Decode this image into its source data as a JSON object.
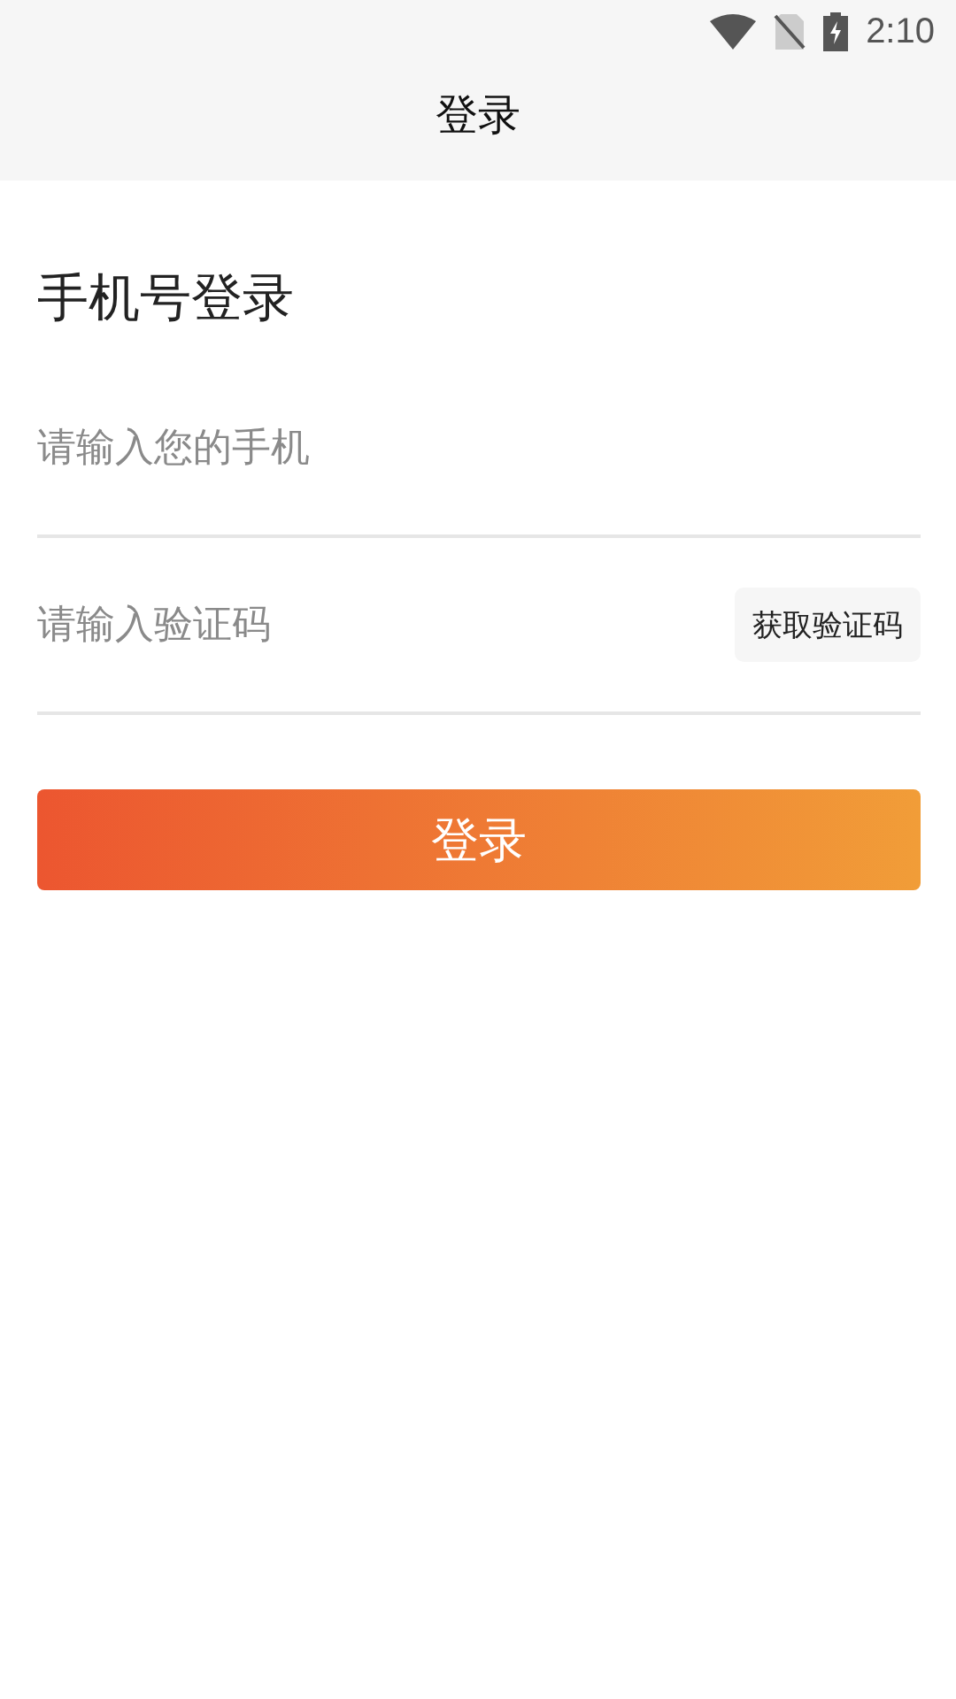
{
  "status_bar": {
    "time": "2:10"
  },
  "header": {
    "title": "登录"
  },
  "heading": "手机号登录",
  "phone_field": {
    "placeholder": "请输入您的手机"
  },
  "code_field": {
    "placeholder": "请输入验证码",
    "button": "获取验证码"
  },
  "login_button": "登录"
}
